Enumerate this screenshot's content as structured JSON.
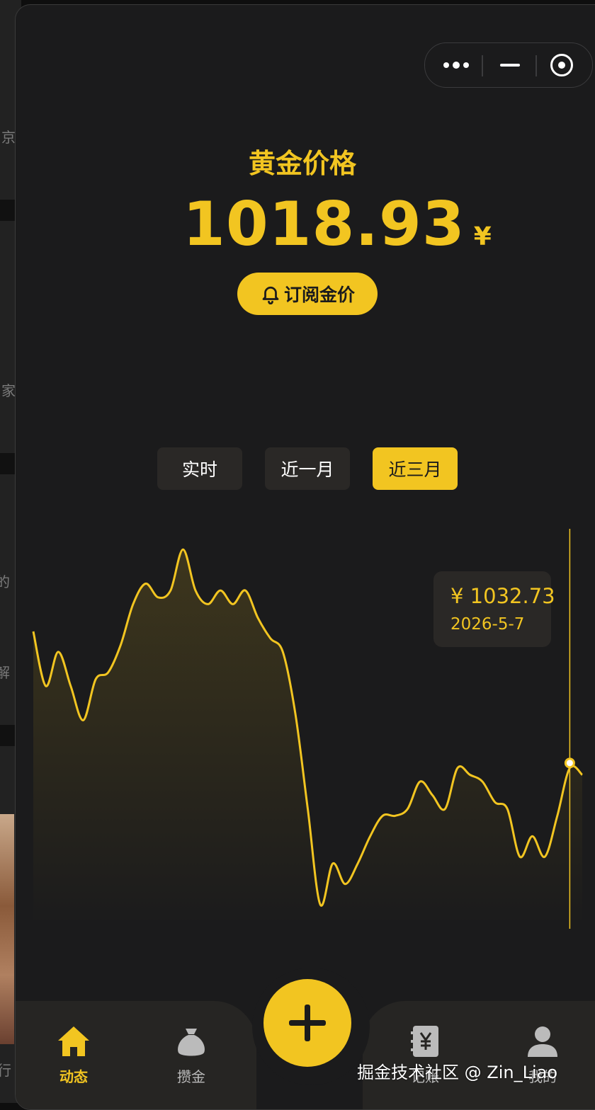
{
  "background_app": {
    "fragments": [
      "京",
      "家",
      "的",
      "解",
      "行"
    ]
  },
  "capsule": {
    "more_icon": "more-dots-icon",
    "minimize_icon": "minimize-icon",
    "close_icon": "target-close-icon"
  },
  "header": {
    "title": "黄金价格",
    "price": "1018.93",
    "currency": "¥"
  },
  "subscribe": {
    "icon": "bell-icon",
    "label": "订阅金价"
  },
  "tabs": [
    {
      "label": "实时",
      "active": false
    },
    {
      "label": "近一月",
      "active": false
    },
    {
      "label": "近三月",
      "active": true
    }
  ],
  "tooltip": {
    "price": "¥ 1032.73",
    "date": "2026-5-7"
  },
  "nav": {
    "items": [
      {
        "label": "动态",
        "icon": "home-icon",
        "active": true
      },
      {
        "label": "攒金",
        "icon": "money-bag-icon",
        "active": false
      },
      {
        "label": "记账",
        "icon": "ledger-yen-icon",
        "active": false
      },
      {
        "label": "我的",
        "icon": "user-icon",
        "active": false
      }
    ],
    "fab_icon": "plus-icon"
  },
  "watermark": "掘金技术社区 @ Zin_Liao",
  "colors": {
    "accent": "#f2c521",
    "background": "#1b1b1c",
    "surface": "#2a2826"
  },
  "chart_data": {
    "type": "area",
    "y": [
      1052,
      1044,
      1049,
      1044,
      1039,
      1045,
      1046,
      1050,
      1056,
      1059,
      1057,
      1058,
      1064,
      1058,
      1056,
      1058,
      1056,
      1058,
      1054,
      1051,
      1049,
      1040,
      1026,
      1012,
      1018,
      1015,
      1018,
      1022,
      1025,
      1025,
      1026,
      1030,
      1028,
      1026,
      1032,
      1031,
      1030,
      1027,
      1026,
      1019,
      1022,
      1019,
      1025,
      1032,
      1031
    ],
    "highlight_index": 43,
    "highlight_y": 1032.73,
    "highlight_date": "2026-5-7",
    "grid": false
  }
}
